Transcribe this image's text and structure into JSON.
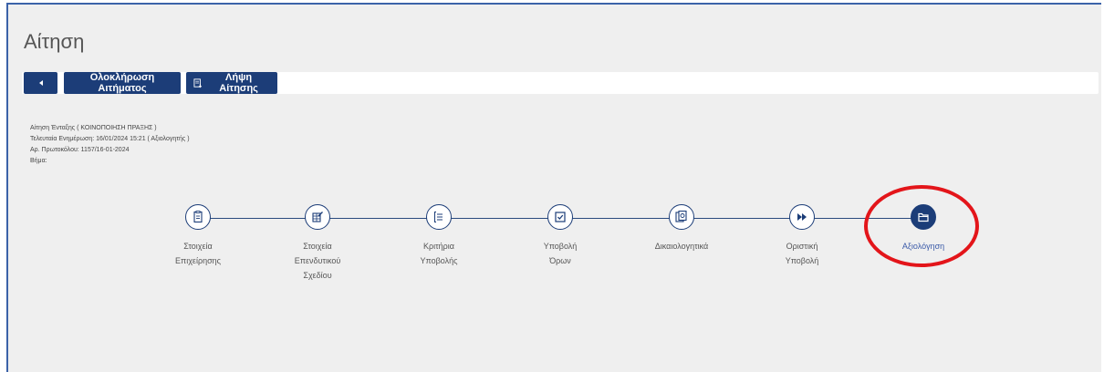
{
  "page": {
    "title": "Αίτηση"
  },
  "toolbar": {
    "complete_label": "Ολοκλήρωση Αιτήματος",
    "download_label": "Λήψη Αίτησης"
  },
  "info": {
    "line1": "Αίτηση Ένταξης ( ΚΟΙΝΟΠΟΙΗΣΗ ΠΡΑΞΗΣ )",
    "line2": "Τελευταία Ενημέρωση: 16/01/2024 15:21 ( Αξιολογητής )",
    "line3": "Αρ. Πρωτοκόλου: 1157/16-01-2024",
    "line4": "Βήμα:"
  },
  "steps": [
    {
      "label_l1": "Στοιχεία",
      "label_l2": "Επιχείρησης",
      "label_l3": "",
      "icon": "document-icon"
    },
    {
      "label_l1": "Στοιχεία",
      "label_l2": "Επενδυτικού",
      "label_l3": "Σχεδίου",
      "icon": "edit-grid-icon"
    },
    {
      "label_l1": "Κριτήρια",
      "label_l2": "Υποβολής",
      "label_l3": "",
      "icon": "list-icon"
    },
    {
      "label_l1": "Υποβολή",
      "label_l2": "Όρων",
      "label_l3": "",
      "icon": "checkbox-icon"
    },
    {
      "label_l1": "Δικαιολογητικά",
      "label_l2": "",
      "label_l3": "",
      "icon": "attachment-icon"
    },
    {
      "label_l1": "Οριστική",
      "label_l2": "Υποβολή",
      "label_l3": "",
      "icon": "fast-forward-icon"
    },
    {
      "label_l1": "Αξιολόγηση",
      "label_l2": "",
      "label_l3": "",
      "icon": "folder-icon",
      "active": true
    }
  ],
  "colors": {
    "accent": "#1c3d78",
    "highlight": "#e3151a",
    "background": "#efefef"
  }
}
